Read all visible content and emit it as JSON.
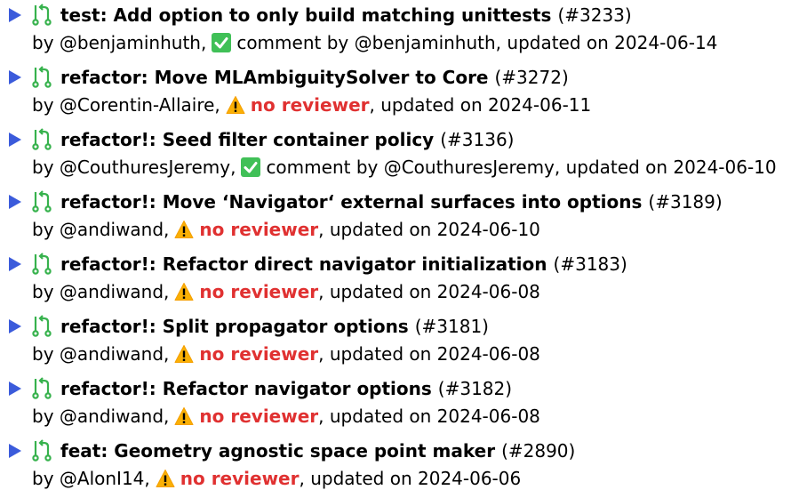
{
  "colors": {
    "arrow": "#3b5bdb",
    "pr_icon": "#37b24d",
    "check_bg": "#40c057",
    "warn_bg": "#fab005",
    "no_reviewer": "#e03131"
  },
  "prs": [
    {
      "title": "test: Add option to only build matching unittests",
      "number": "(#3233)",
      "by": "by @benjaminhuth,",
      "status_icon": "check-icon",
      "status": "comment by @benjaminhuth",
      "updated": ", updated on 2024-06-14"
    },
    {
      "title": "refactor: Move MLAmbiguitySolver to Core",
      "number": "(#3272)",
      "by": "by @Corentin-Allaire,",
      "status_icon": "warning-icon",
      "status": "no reviewer",
      "updated": ", updated on 2024-06-11"
    },
    {
      "title": "refactor!: Seed filter container policy",
      "number": "(#3136)",
      "by": "by @CouthuresJeremy,",
      "status_icon": "check-icon",
      "status": "comment by @CouthuresJeremy",
      "updated": ", updated on 2024-06-10"
    },
    {
      "title": "refactor!: Move ‘Navigator‘ external surfaces into options",
      "number": "(#3189)",
      "by": "by @andiwand,",
      "status_icon": "warning-icon",
      "status": "no reviewer",
      "updated": ", updated on 2024-06-10"
    },
    {
      "title": "refactor!: Refactor direct navigator initialization",
      "number": "(#3183)",
      "by": "by @andiwand,",
      "status_icon": "warning-icon",
      "status": "no reviewer",
      "updated": ", updated on 2024-06-08"
    },
    {
      "title": "refactor!: Split propagator options",
      "number": "(#3181)",
      "by": "by @andiwand,",
      "status_icon": "warning-icon",
      "status": "no reviewer",
      "updated": ", updated on 2024-06-08"
    },
    {
      "title": "refactor!: Refactor navigator options",
      "number": "(#3182)",
      "by": "by @andiwand,",
      "status_icon": "warning-icon",
      "status": "no reviewer",
      "updated": ", updated on 2024-06-08"
    },
    {
      "title": "feat: Geometry agnostic space point maker",
      "number": "(#2890)",
      "by": "by @AlonI14,",
      "status_icon": "warning-icon",
      "status": "no reviewer",
      "updated": ", updated on 2024-06-06"
    }
  ]
}
